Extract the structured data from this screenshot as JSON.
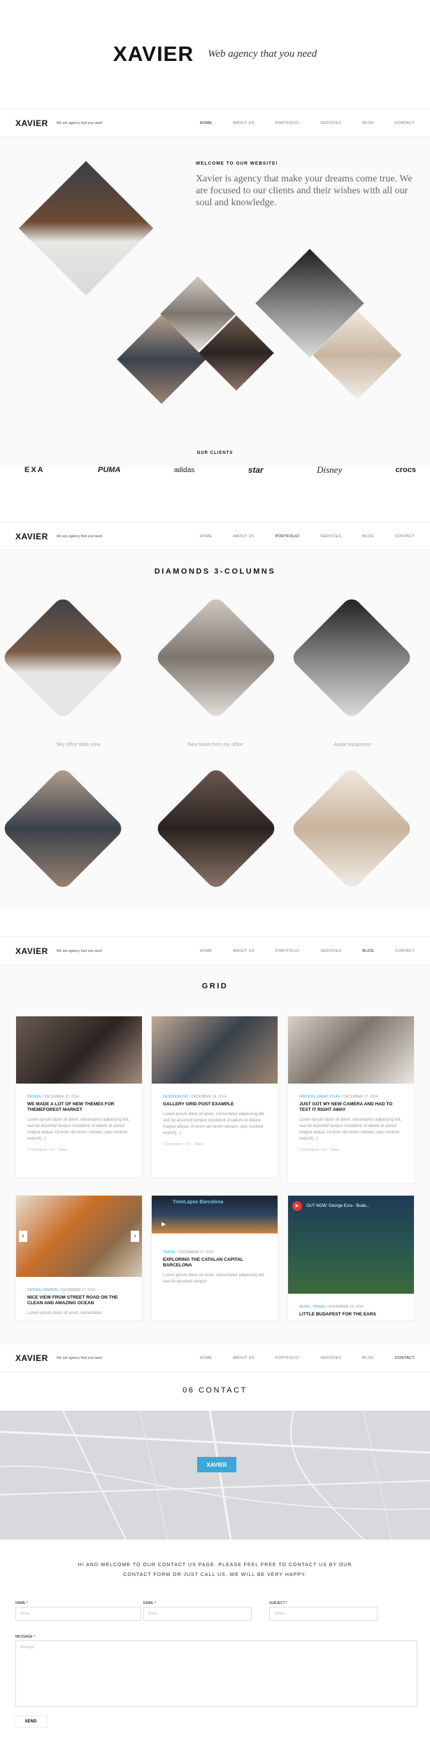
{
  "promo": {
    "logo": "XAVIER",
    "tagline": "Web agency that you need"
  },
  "nav": {
    "logo": "XAVIER",
    "tagline": "We are agency that you need",
    "items": [
      "HOME",
      "ABOUT US",
      "PORTFOLIO",
      "SERVICES",
      "BLOG",
      "CONTACT"
    ]
  },
  "home": {
    "welcome_label": "WELCOME TO OUR WEBSITE!",
    "welcome_text": "Xavier is agency that make your dreams come true. We are focused to our clients and their  wishes with all our soul and knowledge.",
    "clients_label": "OUR CLIENTS",
    "clients": [
      "EXA",
      "PUMA",
      "adidas",
      "star",
      "Disney",
      "crocs"
    ]
  },
  "portfolio": {
    "title": "DIAMONDS 3-COLUMNS",
    "items": [
      {
        "caption": "Sky office table view",
        "color": "#8a6a4f"
      },
      {
        "caption": "New beats from my office",
        "color": "#b9b3ab"
      },
      {
        "caption": "Apple equipment",
        "color": "#777"
      },
      {
        "caption": "",
        "color": "#4d5660"
      },
      {
        "caption": "",
        "color": "#5a4038"
      },
      {
        "caption": "",
        "color": "#e6dfd6"
      }
    ]
  },
  "blog": {
    "title": "GRID",
    "posts": [
      {
        "cat": "DESIGN,",
        "date": "DECEMBER 20, 2014",
        "title": "WE MADE A LOT OF NEW THEMES FOR THEMEFOREST MARKET",
        "excerpt": "Lorem ipsum dolor sit amet, consectetur adipiscing elit, sed do eiusmod tempor incididunt ut labore et dolore magna aliqua. Ut enim ad minim veniam, quis nostrud exercit[...]",
        "footer": "0 Comments  ·  ♥ 1  ·  Share",
        "color": "#564842"
      },
      {
        "cat": "DESIGN,MUSIC",
        "date": "DECEMBER 18, 2014",
        "title": "GALLERY GRID POST EXAMPLE",
        "excerpt": "Lorem ipsum dolor sit amet, consectetur adipiscing elit, sed do eiusmod tempor incididunt ut labore et dolore magna aliqua. Ut enim ad minim veniam, quis nostrud exercit[...]",
        "footer": "0 Comments  ·  ♥ 0  ·  Share",
        "color": "#6b7480"
      },
      {
        "cat": "FASHION, GREAT STUFF",
        "date": "DECEMBER 17, 2014",
        "title": "JUST GOT MY NEW CAMERA AND HAD TO TEST IT RIGHT AWAY",
        "excerpt": "Lorem ipsum dolor sit amet, consectetur adipiscing elit, sed do eiusmod tempor incididunt ut labore et dolore magna aliqua. Ut enim ad minim veniam, quis nostrud exercit[...]",
        "footer": "0 Comments  ·  ♥ 0  ·  Share",
        "color": "#b8afa4"
      },
      {
        "cat": "DESIGN, FASHION",
        "date": "DECEMBER 17, 2014",
        "title": "NICE VIEW FROM STREET ROAD ON THE CLEAN AND AMAZING OCEAN",
        "excerpt": "Lorem ipsum dolor sit amet, consectetur",
        "footer": "",
        "color": "#c1752c"
      },
      {
        "cat": "TRAVEL",
        "date": "DECEMBER 17, 2014",
        "title": "EXPLORING THE CATALAN CAPITAL BARCELONA",
        "excerpt": "Lorem ipsum dolor sit amet, consectetur adipiscing elit, sed do eiusmod tempor",
        "footer": "",
        "color": "#2f3a4a"
      },
      {
        "cat": "MUSIC, TRAVEL",
        "date": "NOVEMBER 15, 2014",
        "title": "LITTLE BUDAPEST FOR THE EARS",
        "excerpt": "",
        "footer": "",
        "color": "#2c4a45"
      }
    ],
    "video_title": "TimeLapse Barcelona",
    "audio_title": "OUT NOW: George Ezra - Buda..."
  },
  "contact": {
    "title": "06 CONTACT",
    "map_badge": "XAVIER",
    "hello": "HI AND WELCOME TO OUR CONTACT US PAGE. PLEASE FEEL FREE TO CONTACT US BY OUR CONTACT FORM OR JUST CALL US. WE WILL BE VERY HAPPY.",
    "name_label": "NAME *",
    "name_placeholder": "Name",
    "email_label": "EMAIL *",
    "email_placeholder": "Email",
    "subject_label": "SUBJECT *",
    "subject_placeholder": "Subject",
    "message_label": "MESSAGE *",
    "message_placeholder": "Message",
    "send_label": "SEND"
  }
}
